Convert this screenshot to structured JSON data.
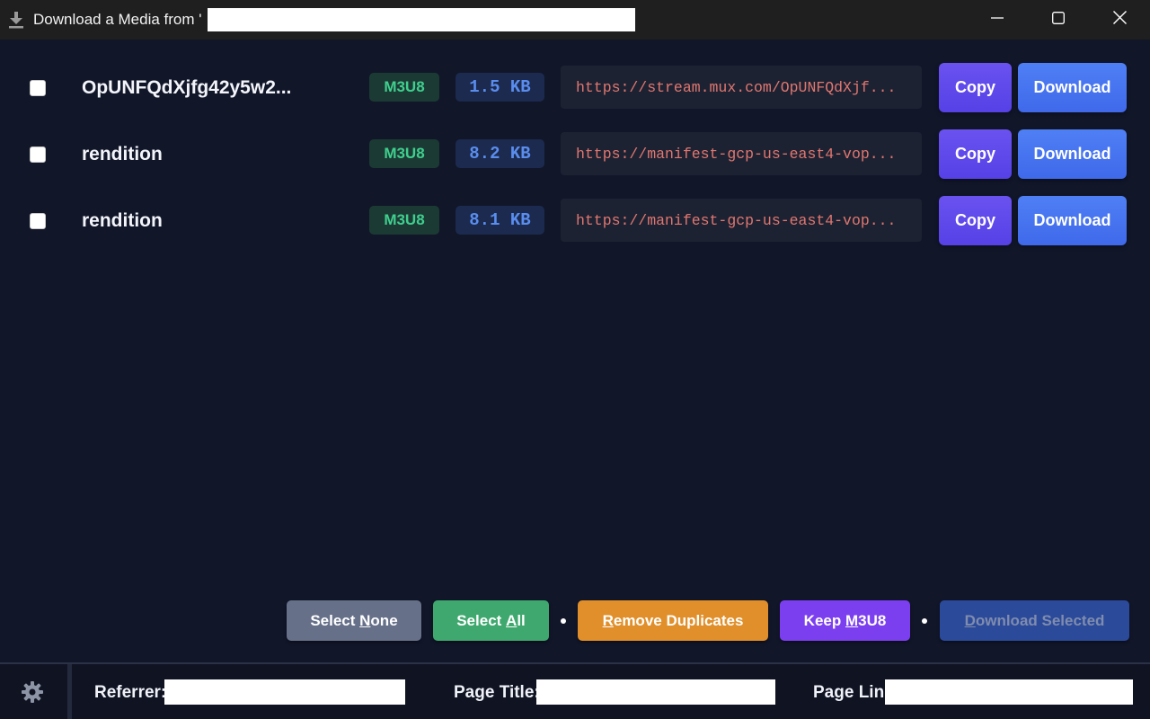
{
  "window": {
    "title": "Download a Media from '",
    "icon": "download-icon",
    "controls": [
      "minimize-icon",
      "maximize-icon",
      "close-icon"
    ]
  },
  "media": [
    {
      "name": "OpUNFQdXjfg42y5w2...",
      "type": "M3U8",
      "size": "1.5 KB",
      "url": "https://stream.mux.com/OpUNFQdXjf...",
      "copy_label": "Copy",
      "download_label": "Download",
      "checked": false
    },
    {
      "name": "rendition",
      "type": "M3U8",
      "size": "8.2 KB",
      "url": "https://manifest-gcp-us-east4-vop...",
      "copy_label": "Copy",
      "download_label": "Download",
      "checked": false
    },
    {
      "name": "rendition",
      "type": "M3U8",
      "size": "8.1 KB",
      "url": "https://manifest-gcp-us-east4-vop...",
      "copy_label": "Copy",
      "download_label": "Download",
      "checked": false
    }
  ],
  "actions": {
    "select_none": {
      "prefix": "Select ",
      "accel": "N",
      "suffix": "one"
    },
    "select_all": {
      "prefix": "Select ",
      "accel": "A",
      "suffix": "ll"
    },
    "remove_duplicates": {
      "prefix": "",
      "accel": "R",
      "suffix": "emove Duplicates"
    },
    "keep_m3u8": {
      "prefix": "Keep ",
      "accel": "M",
      "suffix": "3U8"
    },
    "download_selected": {
      "prefix": "",
      "accel": "D",
      "suffix": "ownload Selected"
    }
  },
  "footer": {
    "referrer_label": "Referrer:",
    "page_title_label": "Page Title:",
    "page_link_label": "Page Link"
  },
  "colors": {
    "background": "#111629",
    "select_none": "#667089",
    "select_all": "#3fa86e",
    "remove_duplicates": "#e08f2a",
    "keep_m3u8": "#7b3ff0",
    "download_selected": "#2b4a9a"
  }
}
